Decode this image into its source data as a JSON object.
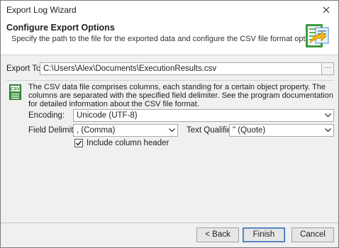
{
  "window": {
    "title": "Export Log Wizard"
  },
  "header": {
    "title": "Configure Export Options",
    "subtitle": "Specify the path to the file for the exported data and configure the CSV file format options.",
    "icon": "export-to-file-icon"
  },
  "export": {
    "label": "Export To:",
    "path": "C:\\Users\\Alex\\Documents\\ExecutionResults.csv",
    "browse_label": "···"
  },
  "csv": {
    "icon": "csv-file-icon",
    "description": "The CSV data file comprises columns, each standing for a certain object property. The columns are separated with the specified field delimiter. See the program documentation for detailed information about the CSV file format.",
    "encoding_label": "Encoding:",
    "encoding_value": "Unicode (UTF-8)",
    "delimiter_label": "Field Delimiter:",
    "delimiter_value": ", (Comma)",
    "qualifier_label": "Text Qualifier:",
    "qualifier_value": "\" (Quote)",
    "include_header_label": "Include column header",
    "include_header_checked": true
  },
  "buttons": {
    "back": "< Back",
    "finish": "Finish",
    "cancel": "Cancel"
  }
}
